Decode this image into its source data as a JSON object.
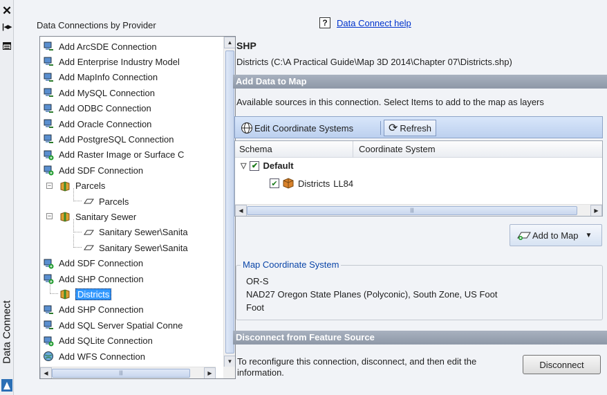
{
  "palette": {
    "strip_title": "Data Connect"
  },
  "tree": {
    "title": "Data Connections by Provider",
    "items": [
      {
        "label": "Add ArcSDE Connection"
      },
      {
        "label": "Add Enterprise Industry Model"
      },
      {
        "label": "Add MapInfo Connection"
      },
      {
        "label": "Add MySQL Connection"
      },
      {
        "label": "Add ODBC Connection"
      },
      {
        "label": "Add Oracle Connection"
      },
      {
        "label": "Add PostgreSQL Connection"
      },
      {
        "label": "Add Raster Image or Surface C"
      },
      {
        "label": "Add SDF Connection"
      },
      {
        "label": "Parcels"
      },
      {
        "label": "Parcels"
      },
      {
        "label": "Sanitary Sewer"
      },
      {
        "label": "Sanitary Sewer\\Sanita"
      },
      {
        "label": "Sanitary Sewer\\Sanita"
      },
      {
        "label": "Add SDF Connection"
      },
      {
        "label": "Add SHP Connection"
      },
      {
        "label": "Districts"
      },
      {
        "label": "Add SHP Connection"
      },
      {
        "label": "Add SQL Server Spatial Conne"
      },
      {
        "label": "Add SQLite Connection"
      },
      {
        "label": "Add WFS Connection"
      }
    ]
  },
  "help": {
    "label": "Data Connect help"
  },
  "connection": {
    "name": "SHP",
    "path": "Districts (C:\\A Practical Guide\\Map 3D 2014\\Chapter 07\\Districts.shp)"
  },
  "add_data": {
    "section_title": "Add Data to Map",
    "instructions": "Available sources in this connection.  Select Items to add to the map as layers",
    "toolbar": {
      "edit_cs": "Edit Coordinate Systems",
      "refresh": "Refresh"
    },
    "grid": {
      "col_schema": "Schema",
      "col_cs": "Coordinate System",
      "schema_row": "Default",
      "item_name": "Districts",
      "item_cs": "LL84"
    },
    "add_to_map": "Add to Map"
  },
  "map_cs": {
    "legend": "Map Coordinate System",
    "code": "OR-S",
    "description": "NAD27 Oregon State Planes (Polyconic), South Zone, US Foot",
    "units": "Foot"
  },
  "disconnect": {
    "section_title": "Disconnect from Feature Source",
    "text": "To reconfigure this connection, disconnect, and then edit the information.",
    "button": "Disconnect"
  }
}
